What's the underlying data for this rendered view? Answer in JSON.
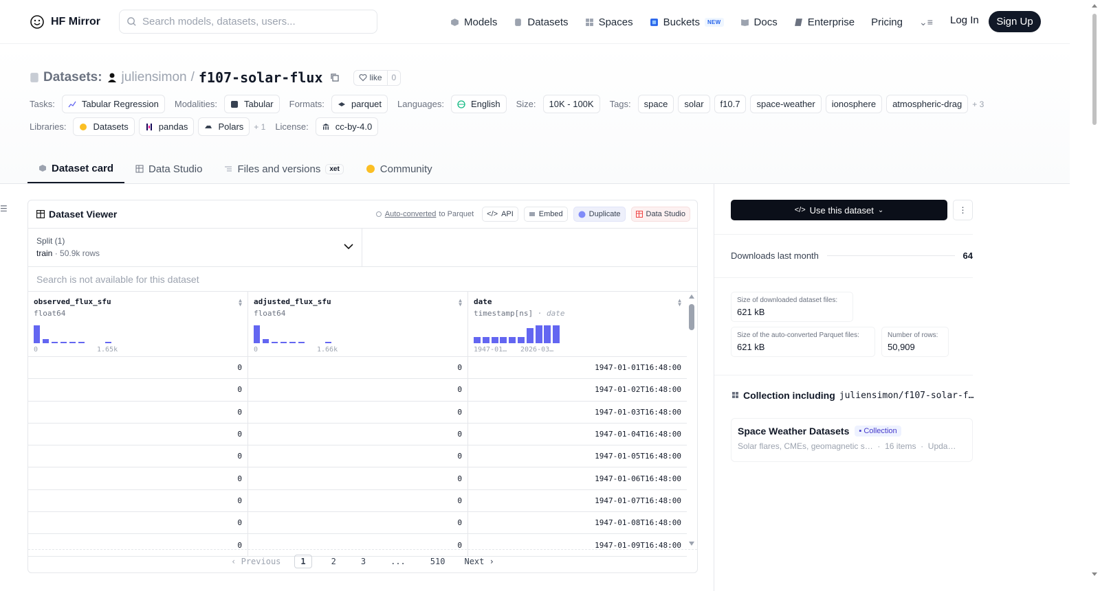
{
  "nav": {
    "brand": "HF Mirror",
    "search_placeholder": "Search models, datasets, users...",
    "links": [
      {
        "label": "Models",
        "icon": "cube-icon"
      },
      {
        "label": "Datasets",
        "icon": "database-icon"
      },
      {
        "label": "Spaces",
        "icon": "grid-icon"
      },
      {
        "label": "Buckets",
        "icon": "bucket-icon",
        "badge": "NEW"
      },
      {
        "label": "Docs",
        "icon": "book-icon"
      },
      {
        "label": "Enterprise",
        "icon": "enterprise-icon"
      },
      {
        "label": "Pricing"
      }
    ],
    "login": "Log In",
    "signup": "Sign Up"
  },
  "header": {
    "section": "Datasets:",
    "owner": "juliensimon",
    "separator": "/",
    "name": "f107-solar-flux",
    "like_label": "like",
    "like_count": "0",
    "tasks_label": "Tasks:",
    "tasks": [
      "Tabular Regression"
    ],
    "modalities_label": "Modalities:",
    "modalities": [
      "Tabular"
    ],
    "formats_label": "Formats:",
    "formats": [
      "parquet"
    ],
    "languages_label": "Languages:",
    "languages": [
      "English"
    ],
    "size_label": "Size:",
    "size": "10K - 100K",
    "tags_label": "Tags:",
    "tags": [
      "space",
      "solar",
      "f10.7",
      "space-weather",
      "ionosphere",
      "atmospheric-drag"
    ],
    "tags_more": "+ 3",
    "libraries_label": "Libraries:",
    "libraries": [
      "Datasets",
      "pandas",
      "Polars"
    ],
    "libraries_more": "+ 1",
    "license_label": "License:",
    "license": "cc-by-4.0"
  },
  "tabs": [
    {
      "label": "Dataset card",
      "active": true
    },
    {
      "label": "Data Studio"
    },
    {
      "label": "Files and versions",
      "badge": "xet"
    },
    {
      "label": "Community"
    }
  ],
  "viewer": {
    "title": "Dataset Viewer",
    "auto_converted": "Auto-converted",
    "auto_converted_suffix": " to Parquet",
    "buttons": [
      "API",
      "Embed",
      "Duplicate",
      "Data Studio"
    ],
    "split_label": "Split (1)",
    "split_value": "train",
    "split_dot": "·",
    "split_rows": "50.9k rows",
    "search_note": "Search is not available for this dataset",
    "columns": [
      {
        "name": "observed_flux_sfu",
        "type": "float64",
        "min": "0",
        "max": "1.65k",
        "hist": [
          0.95,
          0.22,
          0.06,
          0.05,
          0.05,
          0.05,
          0.0,
          0.0,
          0.04
        ]
      },
      {
        "name": "adjusted_flux_sfu",
        "type": "float64",
        "min": "0",
        "max": "1.66k",
        "hist": [
          0.95,
          0.22,
          0.06,
          0.05,
          0.05,
          0.05,
          0.0,
          0.0,
          0.04
        ]
      },
      {
        "name": "date",
        "type": "timestamp[ns]",
        "type_extra": "date",
        "min": "1947-01…",
        "max": "2026-03…",
        "hist": [
          0.35,
          0.35,
          0.35,
          0.35,
          0.35,
          0.35,
          0.8,
          0.95,
          0.95,
          0.95
        ]
      }
    ],
    "rows": [
      [
        "0",
        "0",
        "1947-01-01T16:48:00"
      ],
      [
        "0",
        "0",
        "1947-01-02T16:48:00"
      ],
      [
        "0",
        "0",
        "1947-01-03T16:48:00"
      ],
      [
        "0",
        "0",
        "1947-01-04T16:48:00"
      ],
      [
        "0",
        "0",
        "1947-01-05T16:48:00"
      ],
      [
        "0",
        "0",
        "1947-01-06T16:48:00"
      ],
      [
        "0",
        "0",
        "1947-01-07T16:48:00"
      ],
      [
        "0",
        "0",
        "1947-01-08T16:48:00"
      ],
      [
        "0",
        "0",
        "1947-01-09T16:48:00"
      ]
    ],
    "pager": {
      "prev": "Previous",
      "pages": [
        "1",
        "2",
        "3",
        "...",
        "510"
      ],
      "current": "1",
      "next": "Next"
    }
  },
  "sidebar": {
    "use_button": "Use this dataset",
    "downloads_label": "Downloads last month",
    "downloads_value": "64",
    "stats": [
      {
        "label": "Size of downloaded dataset files:",
        "value": "621 kB"
      },
      {
        "label": "Size of the auto-converted Parquet files:",
        "value": "621 kB"
      },
      {
        "label": "Number of rows:",
        "value": "50,909"
      }
    ],
    "collection_heading": "Collection including",
    "collection_repo": "juliensimon/f107-solar-f…",
    "collection_name": "Space Weather Datasets",
    "collection_badge": "Collection",
    "collection_desc": "Solar flares, CMEs, geomagnetic s…",
    "collection_items": "16 items",
    "collection_updated": "Upda…"
  },
  "colors": {
    "accent": "#6366f1",
    "dark": "#111827"
  }
}
